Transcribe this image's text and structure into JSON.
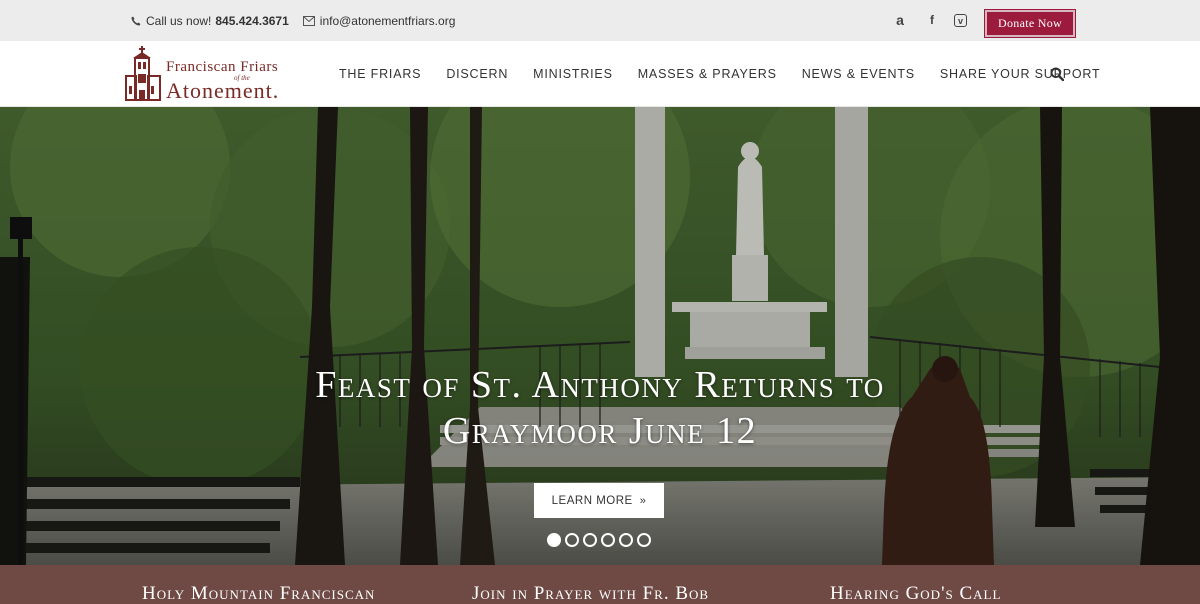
{
  "topbar": {
    "phone_label": "Call us now!",
    "phone": "845.424.3671",
    "email": "info@atonementfriars.org",
    "social": [
      {
        "icon": "amazon-icon",
        "glyph": "a"
      },
      {
        "icon": "facebook-icon",
        "glyph": "f"
      },
      {
        "icon": "vimeo-icon",
        "glyph": "v"
      }
    ],
    "donate_label": "Donate Now"
  },
  "logo": {
    "line1": "Franciscan Friars",
    "line2": "of the",
    "line3": "Atonement."
  },
  "nav": {
    "items": [
      "THE FRIARS",
      "DISCERN",
      "MINISTRIES",
      "MASSES & PRAYERS",
      "NEWS & EVENTS",
      "SHARE YOUR SUPPORT"
    ]
  },
  "hero": {
    "headline_line1": "Feast of St. Anthony Returns to",
    "headline_line2": "Graymoor June 12",
    "button_label": "LEARN MORE",
    "slides_total": 6,
    "active_slide": 1
  },
  "features": [
    "Holy Mountain Franciscan",
    "Join in Prayer with Fr. Bob",
    "Hearing God's Call"
  ],
  "colors": {
    "accent": "#9c1a3c",
    "logo": "#7a2a26",
    "band": "#6f4a45",
    "topbar": "#ececec"
  }
}
